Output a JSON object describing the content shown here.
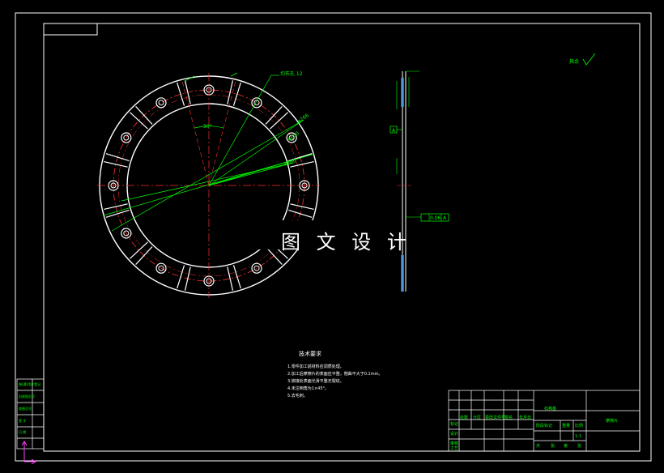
{
  "watermark": "图 文 设 计",
  "roughness_note": "其余",
  "leader_note": "均布孔 12",
  "diameters": [
    "φ266",
    "φ250",
    "φ160"
  ],
  "angle_label": "30°",
  "technical_requirements": {
    "title": "技术要求",
    "items": [
      "1.零件加工前材料应调质处理。",
      "2.加工后摩擦片的表面应平整，翘曲不大于0.1mm。",
      "3.铆接处表面光滑平整无裂纹。",
      "4.未注倒角为1×45°。",
      "5.去毛刺。"
    ]
  },
  "flatness_tolerance": "0.06",
  "datum": "A",
  "title_block": {
    "material": "石棉基",
    "part_name": "摩擦片",
    "scale": "1:1",
    "row_labels": [
      "标记",
      "设计",
      "审核",
      "工艺"
    ],
    "col_labels": [
      "处数",
      "分区",
      "更改文件号",
      "签名",
      "年月日"
    ],
    "stage_labels": [
      "阶段标记",
      "重量",
      "比例"
    ],
    "sheet_labels": [
      "共",
      "张",
      "第",
      "张"
    ]
  },
  "left_strip": [
    "借(通)用件登记",
    "旧底图总号",
    "底图总号",
    "签 字",
    "日 期"
  ]
}
